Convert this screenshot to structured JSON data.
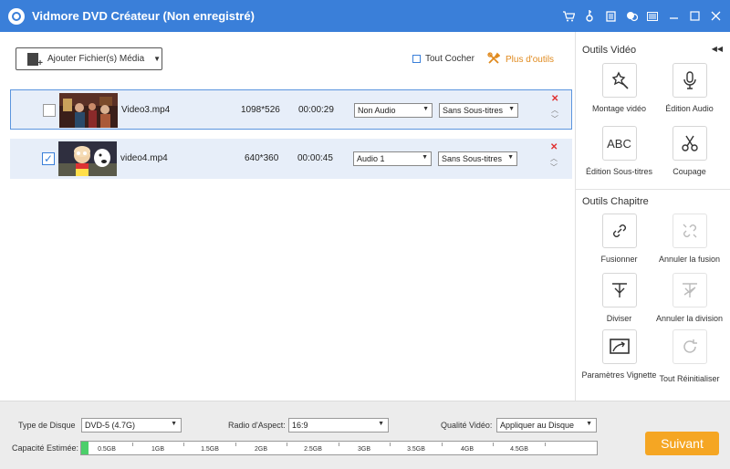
{
  "window": {
    "title": "Vidmore DVD Créateur (Non enregistré)",
    "icons": [
      "cart-icon",
      "key-icon",
      "document-icon",
      "chat-icon",
      "menu-icon",
      "minimize-icon",
      "maximize-icon",
      "close-icon"
    ]
  },
  "toolbar": {
    "add_label": "Ajouter Fichier(s) Média",
    "select_all_label": "Tout Cocher",
    "more_tools_label": "Plus d'outils"
  },
  "files": [
    {
      "name": "Video3.mp4",
      "resolution": "1098*526",
      "duration": "00:00:29",
      "audio": "Non Audio",
      "subtitle": "Sans Sous-titres",
      "checked": false
    },
    {
      "name": "video4.mp4",
      "resolution": "640*360",
      "duration": "00:00:45",
      "audio": "Audio 1",
      "subtitle": "Sans Sous-titres",
      "checked": true
    }
  ],
  "video_tools": {
    "title": "Outils Vidéo",
    "items": [
      {
        "label": "Montage vidéo",
        "icon": "magic-wand-icon"
      },
      {
        "label": "Édition Audio",
        "icon": "microphone-icon"
      },
      {
        "label": "Édition Sous-titres",
        "icon": "abc-icon"
      },
      {
        "label": "Coupage",
        "icon": "scissors-icon"
      }
    ]
  },
  "chapter_tools": {
    "title": "Outils Chapitre",
    "items": [
      {
        "label": "Fusionner",
        "icon": "link-icon"
      },
      {
        "label": "Annuler la fusion",
        "icon": "unlink-icon"
      },
      {
        "label": "Diviser",
        "icon": "split-icon"
      },
      {
        "label": "Annuler la division",
        "icon": "unsplit-icon"
      },
      {
        "label": "Paramètres Vignette",
        "icon": "thumbnail-settings-icon"
      },
      {
        "label": "Tout Réinitialiser",
        "icon": "reset-icon"
      }
    ]
  },
  "bottom": {
    "disc_type_label": "Type de Disque",
    "disc_type_value": "DVD-5 (4.7G)",
    "aspect_label": "Radio d'Aspect:",
    "aspect_value": "16:9",
    "quality_label": "Qualité Vidéo:",
    "quality_value": "Appliquer au Disque",
    "capacity_label": "Capacité Estimée:",
    "capacity_ticks": [
      "0.5GB",
      "1GB",
      "1.5GB",
      "2GB",
      "2.5GB",
      "3GB",
      "3.5GB",
      "4GB",
      "4.5GB"
    ],
    "capacity_used_fraction": 0.014,
    "next_label": "Suivant"
  },
  "colors": {
    "title_bar": "#3a7fd9",
    "accent_orange": "#f5a623",
    "capacity_green": "#4ccf6a",
    "row_bg": "#e7eef9"
  }
}
